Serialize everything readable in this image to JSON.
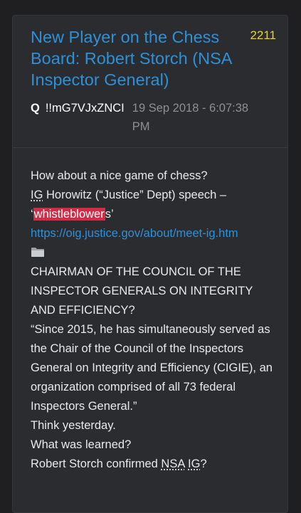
{
  "post": {
    "title": "New Player on the Chess Board: Robert Storch (NSA Inspector General)",
    "number": "2211",
    "author": "Q",
    "tripcode": "!!mG7VJxZNCI",
    "timestamp": "19 Sep 2018 - 6:07:38 PM"
  },
  "body": {
    "line1": "How about a nice game of chess?",
    "line2_ig": "IG",
    "line2_rest": " Horowitz (“Justice” Dept) speech –",
    "line3_open": "‘",
    "line3_highlight": "whistleblower",
    "line3_close": "s’",
    "link": "https://oig.justice.gov/about/meet-ig.htm",
    "icon": "folder-icon",
    "caps": "CHAIRMAN OF THE COUNCIL OF THE INSPECTOR GENERALS ON INTEGRITY AND EFFICIENCY?",
    "quote": "“Since 2015, he has simultaneously served as the Chair of the Council of the Inspectors General on Integrity and Efficiency (CIGIE), an organization comprised of all 73 federal Inspectors General.”",
    "think": "Think yesterday.",
    "learned": "What was learned?",
    "last_prefix": "Robert Storch confirmed ",
    "last_nsa": "NSA",
    "last_space": " ",
    "last_ig": "IG",
    "last_suffix": "?"
  },
  "colors": {
    "background": "#1f1f22",
    "card": "#2b2c30",
    "accent_link": "#2e90d6",
    "post_number": "#e8d52b",
    "highlight": "#d22b45"
  }
}
